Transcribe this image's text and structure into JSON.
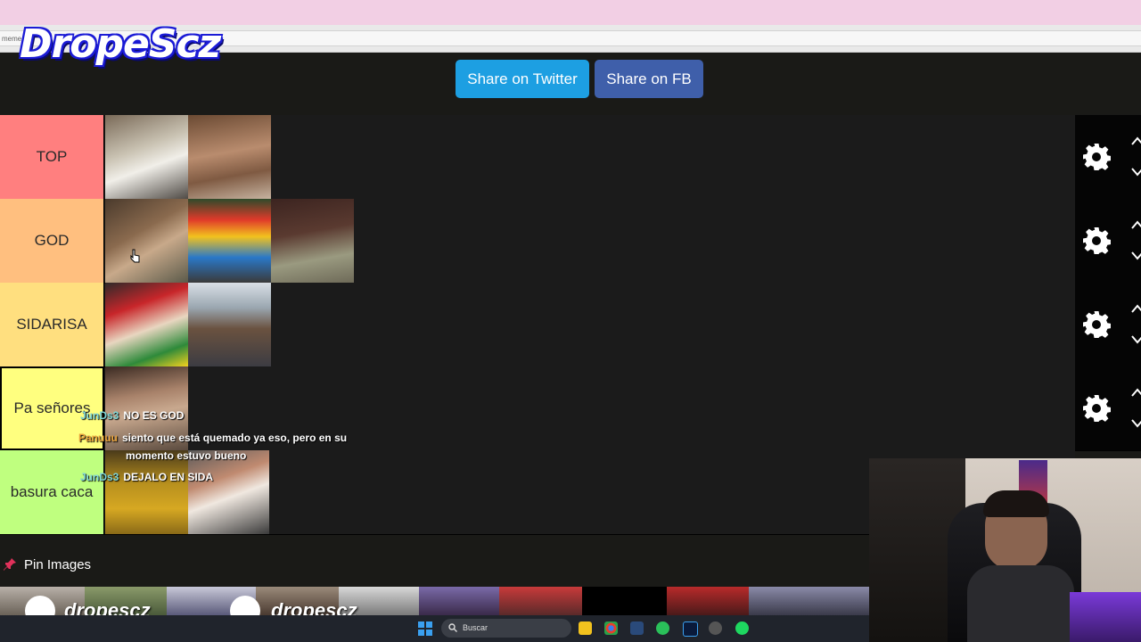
{
  "browser": {
    "url_snippet": "meme"
  },
  "stream": {
    "channel_logo": "DropeScz",
    "watermark_1": "dropescz",
    "watermark_2": "dropescz"
  },
  "share": {
    "twitter_label": "Share on Twitter",
    "fb_label": "Share on FB"
  },
  "tiers": [
    {
      "label": "TOP",
      "color": "#ff7f7f"
    },
    {
      "label": "GOD",
      "color": "#ffbf7f"
    },
    {
      "label": "SIDARISA",
      "color": "#ffdf7f"
    },
    {
      "label": "Pa señores",
      "color": "#ffff7f"
    },
    {
      "label": "basura caca",
      "color": "#bfff7f"
    }
  ],
  "chat": [
    {
      "user": "JunDs3",
      "user_color": "#7fd6d6",
      "text": "NO ES GOD"
    },
    {
      "user": "Panuuu",
      "user_color": "#e8a23a",
      "text": "siento que está quemado ya eso, pero en su",
      "text_cont": "momento estuvo bueno"
    },
    {
      "user": "JunDs3",
      "user_color": "#7fd6d6",
      "text": "DEJALO EN SIDA"
    }
  ],
  "pin": {
    "label": "Pin Images"
  },
  "taskbar": {
    "search_placeholder": "Buscar"
  }
}
